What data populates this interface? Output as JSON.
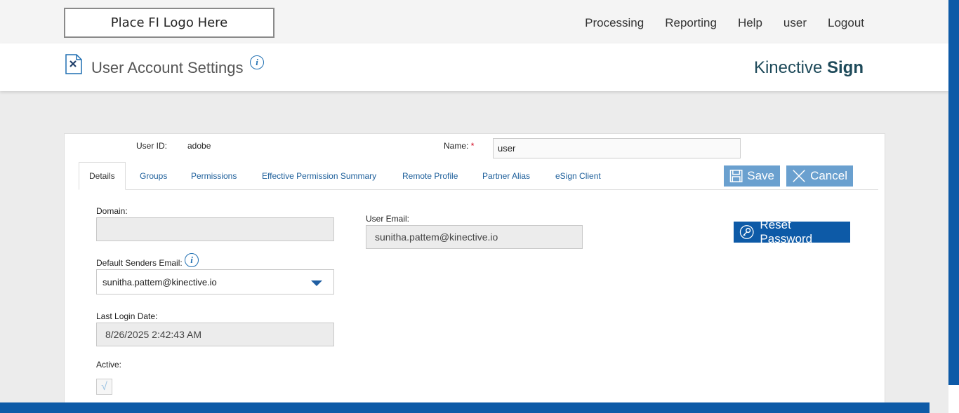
{
  "header": {
    "logo_text": "Place FI Logo Here",
    "nav": [
      "Processing",
      "Reporting",
      "Help",
      "user",
      "Logout"
    ]
  },
  "titlebar": {
    "title": "User Account Settings",
    "brand_light": "Kinective ",
    "brand_bold": "Sign"
  },
  "form": {
    "user_id_label": "User ID:",
    "user_id_value": "adobe",
    "name_label": "Name:",
    "name_required": "*",
    "name_value": "user",
    "tabs": [
      "Details",
      "Groups",
      "Permissions",
      "Effective Permission Summary",
      "Remote Profile",
      "Partner Alias",
      "eSign Client"
    ],
    "save_label": "Save",
    "cancel_label": "Cancel",
    "reset_password_label": "Reset Password",
    "domain_label": "Domain:",
    "domain_value": "",
    "user_email_label": "User Email:",
    "user_email_value": "sunitha.pattem@kinective.io",
    "default_senders_email_label": "Default Senders Email:",
    "default_senders_email_value": "sunitha.pattem@kinective.io",
    "last_login_label": "Last Login Date:",
    "last_login_value": "8/26/2025 2:42:43 AM",
    "active_label": "Active:",
    "active_checked": true
  },
  "colors": {
    "accent": "#0d5aa7",
    "button_light": "#6aa0cf",
    "link": "#1c5e9a"
  }
}
